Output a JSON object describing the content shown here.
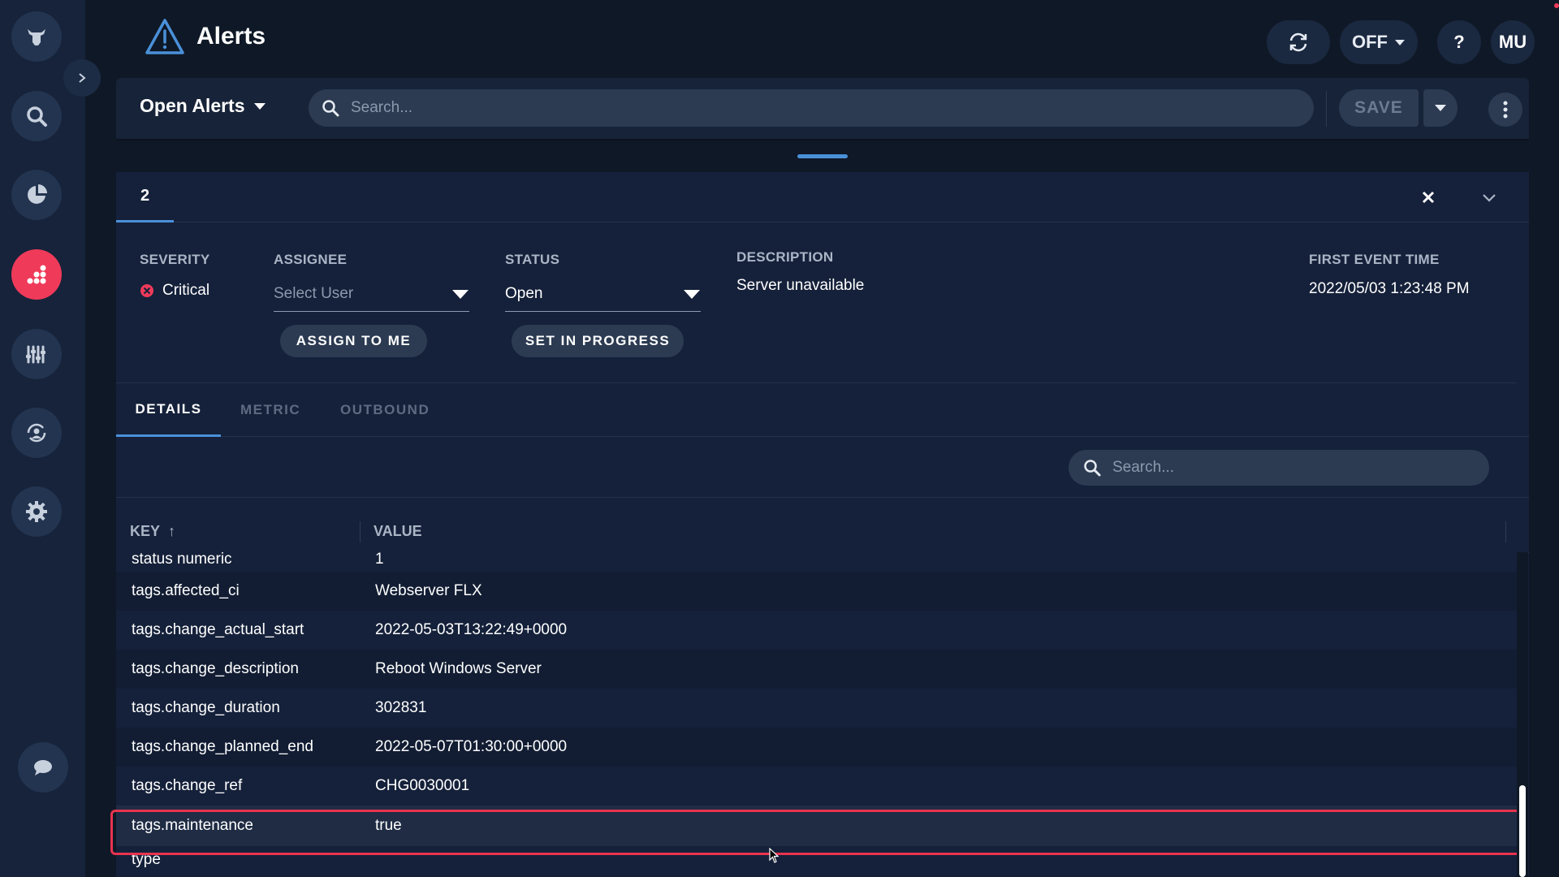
{
  "app": {
    "title": "Alerts",
    "sync_state": "OFF",
    "help_label": "?",
    "user_initials": "MU"
  },
  "sidebar": {
    "items": [
      {
        "name": "logo",
        "icon": "bull-logo-icon"
      },
      {
        "name": "search",
        "icon": "search-icon"
      },
      {
        "name": "dashboards",
        "icon": "pie-chart-icon"
      },
      {
        "name": "alerts",
        "icon": "alerts-icon",
        "active": true
      },
      {
        "name": "settings-sliders",
        "icon": "sliders-icon"
      },
      {
        "name": "integrations",
        "icon": "sync-icon"
      },
      {
        "name": "configuration",
        "icon": "gear-icon"
      },
      {
        "name": "chat",
        "icon": "chat-icon"
      }
    ]
  },
  "filter": {
    "view_label": "Open Alerts",
    "search_placeholder": "Search...",
    "save_label": "SAVE"
  },
  "detail": {
    "alert_tab": "2",
    "severity_label": "SEVERITY",
    "severity_value": "Critical",
    "assignee_label": "ASSIGNEE",
    "assignee_placeholder": "Select User",
    "assign_button": "ASSIGN TO ME",
    "status_label": "STATUS",
    "status_value": "Open",
    "status_button": "SET IN PROGRESS",
    "description_label": "DESCRIPTION",
    "description_value": "Server unavailable",
    "first_event_label": "FIRST EVENT TIME",
    "first_event_value": "2022/05/03 1:23:48 PM",
    "tabs": [
      "DETAILS",
      "METRIC",
      "OUTBOUND"
    ],
    "search_placeholder": "Search...",
    "table": {
      "columns": [
        "KEY",
        "VALUE"
      ],
      "sort_indicator": "↑",
      "rows": [
        {
          "key": "status numeric",
          "value": "1"
        },
        {
          "key": "tags.affected_ci",
          "value": "Webserver FLX"
        },
        {
          "key": "tags.change_actual_start",
          "value": "2022-05-03T13:22:49+0000"
        },
        {
          "key": "tags.change_description",
          "value": "Reboot Windows Server"
        },
        {
          "key": "tags.change_duration",
          "value": "302831"
        },
        {
          "key": "tags.change_planned_end",
          "value": "2022-05-07T01:30:00+0000"
        },
        {
          "key": "tags.change_ref",
          "value": "CHG0030001"
        },
        {
          "key": "tags.maintenance",
          "value": "true"
        },
        {
          "key": "type",
          "value": ""
        }
      ]
    }
  },
  "colors": {
    "accent": "#4a90d9",
    "critical": "#ef3a5a",
    "highlight_border": "#e8334f"
  }
}
